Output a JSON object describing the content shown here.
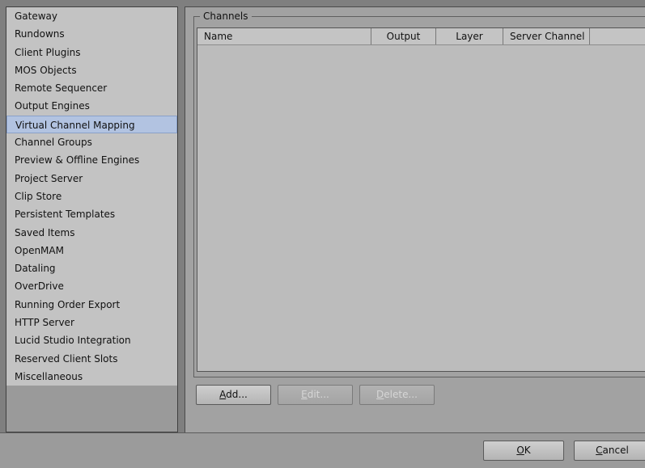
{
  "sidebar": {
    "items": [
      {
        "label": "Gateway"
      },
      {
        "label": "Rundowns"
      },
      {
        "label": "Client Plugins"
      },
      {
        "label": "MOS Objects"
      },
      {
        "label": "Remote Sequencer"
      },
      {
        "label": "Output Engines"
      },
      {
        "label": "Virtual Channel Mapping",
        "selected": true
      },
      {
        "label": "Channel Groups"
      },
      {
        "label": "Preview & Offline Engines"
      },
      {
        "label": "Project Server"
      },
      {
        "label": "Clip Store"
      },
      {
        "label": "Persistent Templates"
      },
      {
        "label": "Saved Items"
      },
      {
        "label": "OpenMAM"
      },
      {
        "label": "Dataling"
      },
      {
        "label": "OverDrive"
      },
      {
        "label": "Running Order Export"
      },
      {
        "label": "HTTP Server"
      },
      {
        "label": "Lucid Studio Integration"
      },
      {
        "label": "Reserved Client Slots"
      },
      {
        "label": "Miscellaneous"
      }
    ]
  },
  "channels": {
    "title": "Channels",
    "columns": [
      "Name",
      "Output",
      "Layer",
      "Server Channel"
    ],
    "rows": []
  },
  "buttons": {
    "add": {
      "mnemonic": "A",
      "rest": "dd..."
    },
    "edit": {
      "mnemonic": "E",
      "rest": "dit..."
    },
    "delete": {
      "mnemonic": "D",
      "rest": "elete..."
    }
  },
  "dialog": {
    "ok": {
      "mnemonic": "O",
      "rest": "K"
    },
    "cancel": {
      "mnemonic": "C",
      "rest": "ancel"
    }
  },
  "colors": {
    "selected_item": "#b2c3e1",
    "panel_bg": "#a2a2a2",
    "list_bg": "#c3c3c3"
  }
}
